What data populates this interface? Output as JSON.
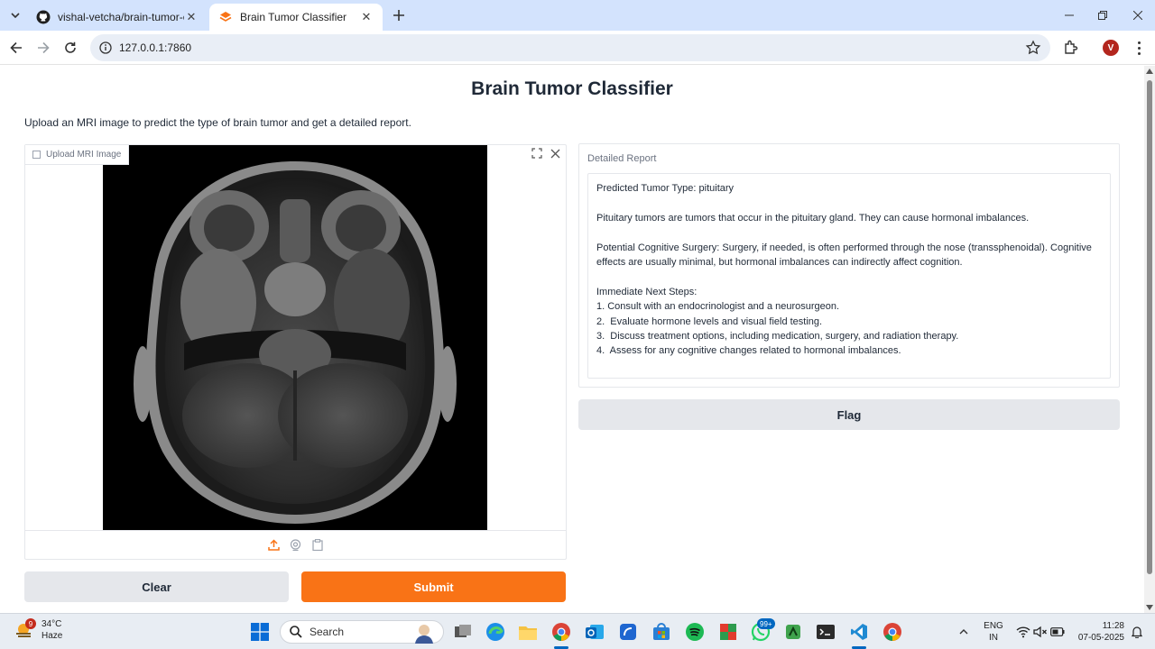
{
  "browser": {
    "tabs": [
      {
        "title": "vishal-vetcha/brain-tumor-classi",
        "active": false
      },
      {
        "title": "Brain Tumor Classifier",
        "active": true
      }
    ],
    "url": "127.0.0.1:7860",
    "profile_initial": "V"
  },
  "page": {
    "title": "Brain Tumor Classifier",
    "description": "Upload an MRI image to predict the type of brain tumor and get a detailed report.",
    "image_input": {
      "label": "Upload MRI Image"
    },
    "buttons": {
      "clear": "Clear",
      "submit": "Submit",
      "flag": "Flag"
    },
    "report": {
      "label": "Detailed Report",
      "lines": [
        "Predicted Tumor Type: pituitary",
        "",
        "Pituitary tumors are tumors that occur in the pituitary gland. They can cause hormonal imbalances.",
        "",
        "Potential Cognitive Surgery: Surgery, if needed, is often performed through the nose (transsphenoidal). Cognitive",
        "effects are usually minimal, but hormonal imbalances can indirectly affect cognition.",
        "",
        "Immediate Next Steps:",
        "1. Consult with an endocrinologist and a neurosurgeon.",
        "2.  Evaluate hormone levels and visual field testing.",
        "3.  Discuss treatment options, including medication, surgery, and radiation therapy.",
        "4.  Assess for any cognitive changes related to hormonal imbalances."
      ]
    }
  },
  "taskbar": {
    "weather": {
      "temp": "34°C",
      "condition": "Haze",
      "badge": "9"
    },
    "search_label": "Search",
    "whatsapp_badge": "99+",
    "language": {
      "lang": "ENG",
      "region": "IN"
    },
    "time": "11:28",
    "date": "07-05-2025"
  },
  "colors": {
    "accent": "#f97316",
    "tabstrip": "#d3e3fd",
    "secondary_button": "#e5e7eb"
  }
}
